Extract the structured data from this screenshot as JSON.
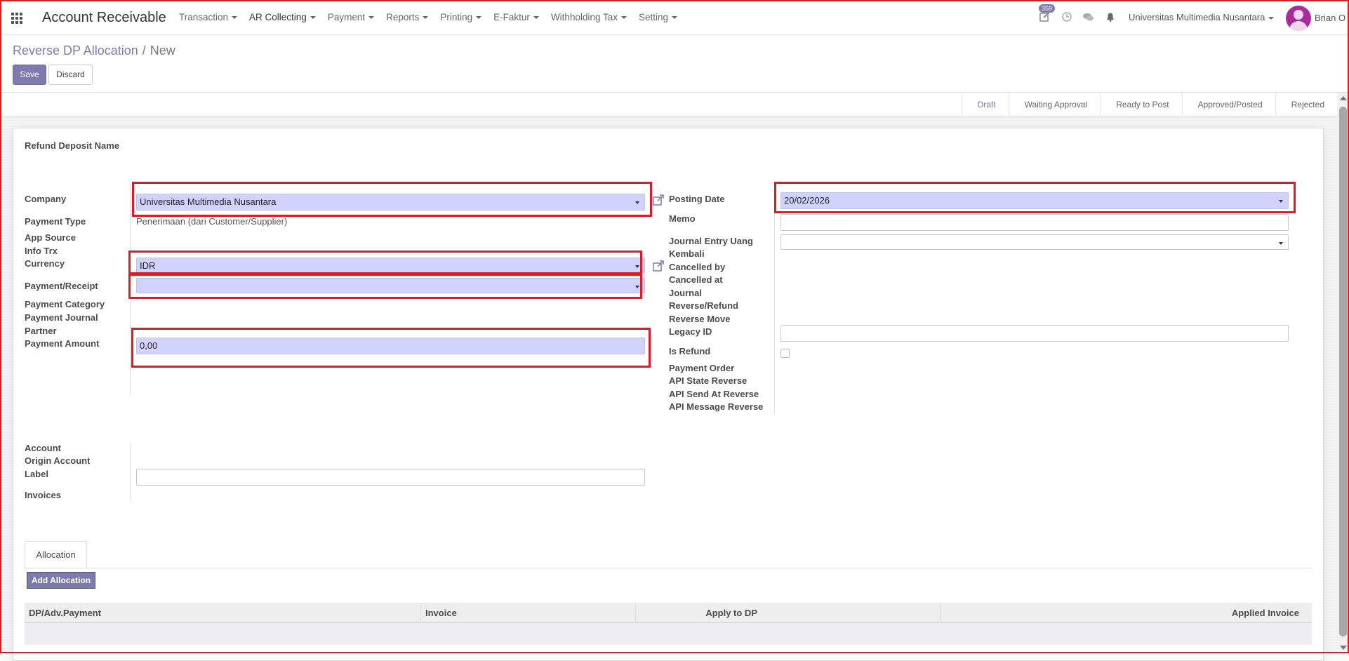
{
  "navbar": {
    "app_title": "Account Receivable",
    "menu": [
      "Transaction",
      "AR Collecting",
      "Payment",
      "Reports",
      "Printing",
      "E-Faktur",
      "Withholding Tax",
      "Setting"
    ],
    "activity_count": "359",
    "company": "Universitas Multimedia Nusantara",
    "user": "Brian O"
  },
  "breadcrumb": {
    "parent": "Reverse DP Allocation",
    "separator": "/",
    "current": "New"
  },
  "buttons": {
    "save": "Save",
    "discard": "Discard",
    "add_allocation": "Add Allocation"
  },
  "status_stages": [
    "Draft",
    "Waiting Approval",
    "Ready to Post",
    "Approved/Posted",
    "Rejected"
  ],
  "form": {
    "title_label": "Refund Deposit Name",
    "left_labels": {
      "company": "Company",
      "payment_type": "Payment Type",
      "app_source": "App Source",
      "info_trx": "Info Trx",
      "currency": "Currency",
      "payment_receipt": "Payment/Receipt",
      "payment_category": "Payment Category",
      "payment_journal": "Payment Journal",
      "partner": "Partner",
      "payment_amount": "Payment Amount",
      "account": "Account",
      "origin_account": "Origin Account",
      "label": "Label",
      "invoices": "Invoices"
    },
    "values": {
      "company": "Universitas Multimedia Nusantara",
      "payment_type": "Penerimaan (dari Customer/Supplier)",
      "currency": "IDR",
      "payment_receipt": "",
      "payment_amount": "0,00",
      "posting_date": "20/02/2026",
      "memo": "",
      "journal_entry_uang_kembali": "",
      "legacy_id": "",
      "label": ""
    },
    "right_labels": {
      "posting_date": "Posting Date",
      "memo": "Memo",
      "journal_entry_uang_kembali_1": "Journal Entry Uang",
      "journal_entry_uang_kembali_2": "Kembali",
      "cancelled_by": "Cancelled by",
      "cancelled_at": "Cancelled at",
      "journal": "Journal",
      "reverse_refund": "Reverse/Refund",
      "reverse_move": "Reverse Move",
      "legacy_id": "Legacy ID",
      "is_refund": "Is Refund",
      "payment_order": "Payment Order",
      "api_state_reverse": "API State Reverse",
      "api_send_at_reverse": "API Send At Reverse",
      "api_message_reverse": "API Message Reverse"
    }
  },
  "tabs": {
    "allocation": "Allocation"
  },
  "table": {
    "columns": [
      "DP/Adv.Payment",
      "Invoice",
      "Apply to DP",
      "Applied Invoice"
    ]
  },
  "colors": {
    "accent": "#7c7bad",
    "required_field": "#d2d2ff",
    "highlight_box": "#e01a22"
  }
}
